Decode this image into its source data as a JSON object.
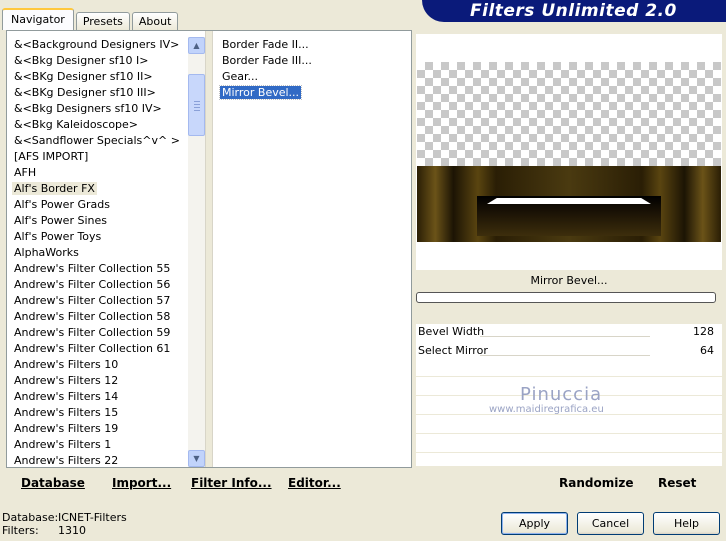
{
  "tabs": [
    "Navigator",
    "Presets",
    "About"
  ],
  "banner_title": "Filters Unlimited 2.0",
  "categories": [
    "&<Background Designers IV>",
    "&<Bkg Designer sf10 I>",
    "&<BKg Designer sf10 II>",
    "&<BKg Designer sf10 III>",
    "&<Bkg Designers sf10 IV>",
    "&<Bkg Kaleidoscope>",
    "&<Sandflower Specials^v^ >",
    "[AFS IMPORT]",
    "AFH",
    "Alf's Border FX",
    "Alf's Power Grads",
    "Alf's Power Sines",
    "Alf's Power Toys",
    "AlphaWorks",
    "Andrew's Filter Collection 55",
    "Andrew's Filter Collection 56",
    "Andrew's Filter Collection 57",
    "Andrew's Filter Collection 58",
    "Andrew's Filter Collection 59",
    "Andrew's Filter Collection 61",
    "Andrew's Filters 10",
    "Andrew's Filters 12",
    "Andrew's Filters 14",
    "Andrew's Filters 15",
    "Andrew's Filters 19",
    "Andrew's Filters 1",
    "Andrew's Filters 22"
  ],
  "selected_category": "Alf's Border FX",
  "filters": [
    "Border Fade II...",
    "Border Fade III...",
    "Gear...",
    "Mirror Bevel..."
  ],
  "selected_filter": "Mirror Bevel...",
  "left_toolbar": {
    "database": "Database",
    "import": "Import...",
    "filter_info": "Filter Info...",
    "editor": "Editor..."
  },
  "filter_title": "Mirror Bevel...",
  "params": [
    {
      "label": "Bevel Width",
      "value": "128"
    },
    {
      "label": "Select Mirror",
      "value": "64"
    }
  ],
  "watermark": {
    "name": "Pinuccia",
    "url": "www.maidiregrafica.eu"
  },
  "right_toolbar": {
    "randomize": "Randomize",
    "reset": "Reset"
  },
  "footer": {
    "database_label": "Database:",
    "database_value": "ICNET-Filters",
    "filters_label": "Filters:",
    "filters_value": "1310"
  },
  "buttons": {
    "apply": "Apply",
    "cancel": "Cancel",
    "help": "Help"
  },
  "colors": {
    "selection": "#316ac5",
    "banner": "#0a1a7a",
    "face": "#ece9d8"
  }
}
